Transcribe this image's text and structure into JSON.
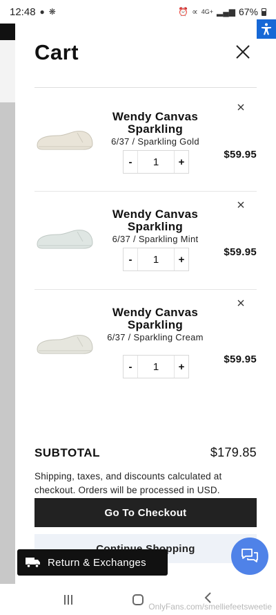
{
  "status_bar": {
    "time": "12:48",
    "battery": "67%",
    "network": "4G+"
  },
  "accessibility": {
    "icon": "accessibility-person-icon"
  },
  "cart": {
    "title": "Cart",
    "close_icon": "close-icon",
    "items": [
      {
        "name": "Wendy Canvas Sparkling",
        "variant": "6/37 / Sparkling Gold",
        "quantity": "1",
        "price": "$59.95",
        "decrement": "-",
        "increment": "+",
        "shoe_color": "#e9e4d8"
      },
      {
        "name": "Wendy Canvas Sparkling",
        "variant": "6/37 / Sparkling Mint",
        "quantity": "1",
        "price": "$59.95",
        "decrement": "-",
        "increment": "+",
        "shoe_color": "#dfe6e3"
      },
      {
        "name": "Wendy Canvas Sparkling",
        "variant": "6/37 / Sparkling Cream",
        "quantity": "1",
        "price": "$59.95",
        "decrement": "-",
        "increment": "+",
        "shoe_color": "#e6e6de"
      }
    ],
    "subtotal_label": "SUBTOTAL",
    "subtotal_value": "$179.85",
    "note": "Shipping, taxes, and discounts calculated at checkout. Orders will be processed in USD.",
    "checkout_label": "Go To Checkout",
    "continue_label": "Continue Shopping"
  },
  "returns": {
    "label": "Return & Exchanges",
    "icon": "truck-icon"
  },
  "chat": {
    "icon": "chat-icon",
    "color": "#4f82e8"
  },
  "watermark": "OnlyFans.com/smelliefeetsweetie"
}
